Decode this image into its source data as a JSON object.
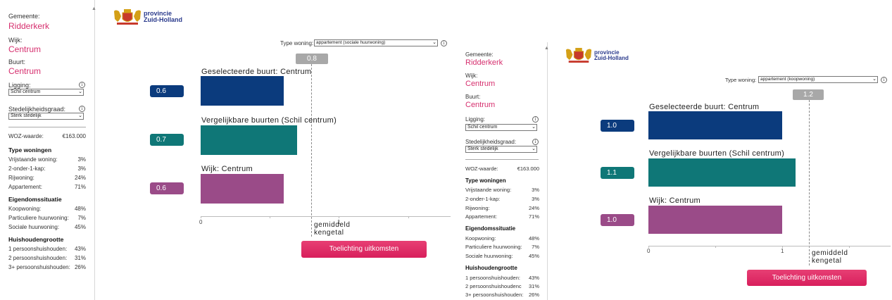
{
  "colors": {
    "accent": "#d62f6e",
    "bar_selected": "#0b3b7d",
    "bar_comparable": "#0f7777",
    "bar_district": "#9a4b88",
    "average": "#a8a8a8",
    "button": "#e02e68"
  },
  "logo": {
    "line1": "provincie",
    "line2": "Zuid-Holland",
    "icon": "coat-of-arms-lions"
  },
  "panels": [
    {
      "sidebar": {
        "gemeente_label": "Gemeente:",
        "gemeente": "Ridderkerk",
        "wijk_label": "Wijk:",
        "wijk": "Centrum",
        "buurt_label": "Buurt:",
        "buurt": "Centrum",
        "ligging_label": "Ligging:",
        "ligging_value": "Schil centrum",
        "sted_label": "Stedelijkheidsgraad:",
        "sted_value": "Sterk stedelijk",
        "woz_label": "WOZ-waarde:",
        "woz_value": "€163.000",
        "type_title": "Type woningen",
        "type_rows": [
          {
            "label": "Vrijstaande woning:",
            "value": "3%"
          },
          {
            "label": "2-onder-1-kap:",
            "value": "3%"
          },
          {
            "label": "Rijwoning:",
            "value": "24%"
          },
          {
            "label": "Appartement:",
            "value": "71%"
          }
        ],
        "eigendom_title": "Eigendomssituatie",
        "eigendom_rows": [
          {
            "label": "Koopwoning:",
            "value": "48%"
          },
          {
            "label": "Particuliere huurwoning:",
            "value": "7%"
          },
          {
            "label": "Sociale huurwoning:",
            "value": "45%"
          }
        ],
        "huish_title": "Huishoudengrootte",
        "huish_rows": [
          {
            "label": "1 persoonshuishouden:",
            "value": "43%"
          },
          {
            "label": "2 persoonshuishouden:",
            "value": "31%"
          },
          {
            "label": "3+ persoonshuishouden:",
            "value": "26%"
          }
        ]
      },
      "main": {
        "type_woning_label": "Type woning:",
        "type_woning_value": "appartement (sociale huurwoning)",
        "average_value": "0.8",
        "bars": [
          {
            "title": "Geselecteerde buurt: Centrum",
            "value": "0.6",
            "fraction": 0.6
          },
          {
            "title": "Vergelijkbare buurten (Schil centrum)",
            "value": "0.7",
            "fraction": 0.7
          },
          {
            "title": "Wijk: Centrum",
            "value": "0.6",
            "fraction": 0.6
          }
        ],
        "axis_tick_labels": [
          "0",
          "1"
        ],
        "average_label_line1": "gemiddeld",
        "average_label_line2": "kengetal",
        "button_label": "Toelichting uitkomsten"
      }
    },
    {
      "sidebar": {
        "gemeente_label": "Gemeente:",
        "gemeente": "Ridderkerk",
        "wijk_label": "Wijk:",
        "wijk": "Centrum",
        "buurt_label": "Buurt:",
        "buurt": "Centrum",
        "ligging_label": "Ligging:",
        "ligging_value": "Schil centrum",
        "sted_label": "Stedelijkheidsgraad:",
        "sted_value": "Sterk stedelijk",
        "woz_label": "WOZ-waarde:",
        "woz_value": "€163.000",
        "type_title": "Type woningen",
        "type_rows": [
          {
            "label": "Vrijstaande woning:",
            "value": "3%"
          },
          {
            "label": "2-onder-1-kap:",
            "value": "3%"
          },
          {
            "label": "Rijwoning:",
            "value": "24%"
          },
          {
            "label": "Appartement:",
            "value": "71%"
          }
        ],
        "eigendom_title": "Eigendomssituatie",
        "eigendom_rows": [
          {
            "label": "Koopwoning:",
            "value": "48%"
          },
          {
            "label": "Particuliere huurwoning:",
            "value": "7%"
          },
          {
            "label": "Sociale huurwoning:",
            "value": "45%"
          }
        ],
        "huish_title": "Huishoudengrootte",
        "huish_rows": [
          {
            "label": "1 persoonshuishouden:",
            "value": "43%"
          },
          {
            "label": "2 persoonshuishoudenc",
            "value": "31%"
          },
          {
            "label": "3+ persoonshuishouden:",
            "value": "26%"
          }
        ]
      },
      "main": {
        "type_woning_label": "Type woning:",
        "type_woning_value": "appartement (koopwoning)",
        "average_value": "1.2",
        "bars": [
          {
            "title": "Geselecteerde buurt: Centrum",
            "value": "1.0",
            "fraction": 1.0
          },
          {
            "title": "Vergelijkbare buurten (Schil centrum)",
            "value": "1.1",
            "fraction": 1.1
          },
          {
            "title": "Wijk: Centrum",
            "value": "1.0",
            "fraction": 1.0
          }
        ],
        "axis_tick_labels": [
          "0",
          "1"
        ],
        "average_label_line1": "gemiddeld",
        "average_label_line2": "kengetal",
        "button_label": "Toelichting uitkomsten"
      }
    }
  ]
}
